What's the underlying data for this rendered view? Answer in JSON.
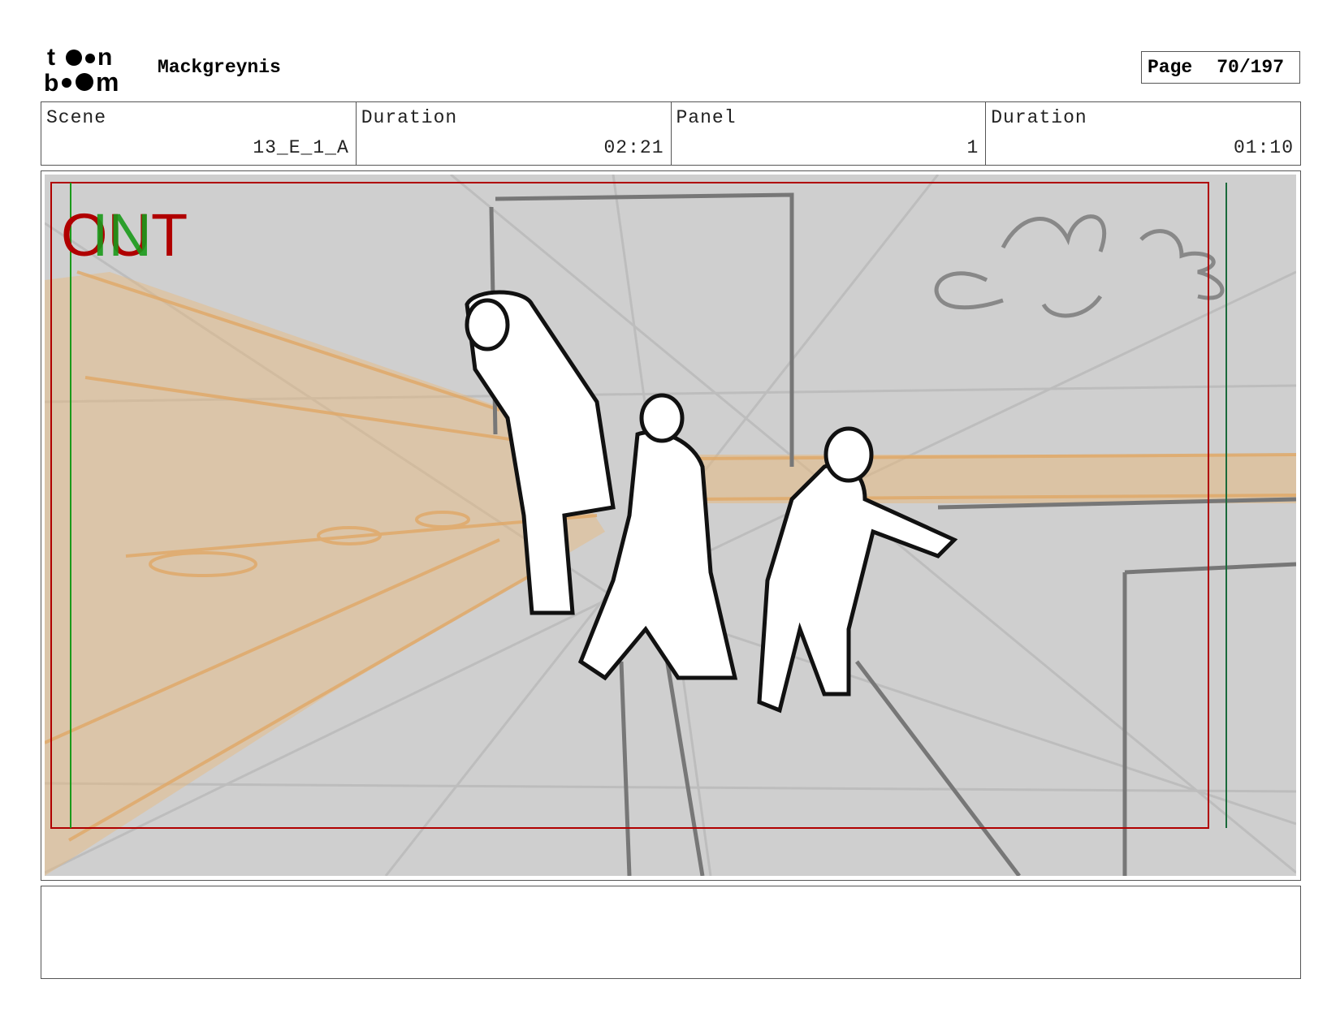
{
  "header": {
    "logo_text": "toon boom",
    "project_name": "Mackgreynis",
    "page_label": "Page",
    "page_value": "70/197"
  },
  "info": {
    "scene_label": "Scene",
    "scene_value": "13_E_1_A",
    "scene_duration_label": "Duration",
    "scene_duration_value": "02:21",
    "panel_label": "Panel",
    "panel_value": "1",
    "panel_duration_label": "Duration",
    "panel_duration_value": "01:10"
  },
  "frame": {
    "out_marker": "OUT",
    "in_marker": "IN",
    "colors": {
      "out": "#b00000",
      "in": "#1a9a1a",
      "wall": "#e8b77a",
      "background": "#cfcfcf"
    }
  },
  "notes": {
    "text": ""
  }
}
